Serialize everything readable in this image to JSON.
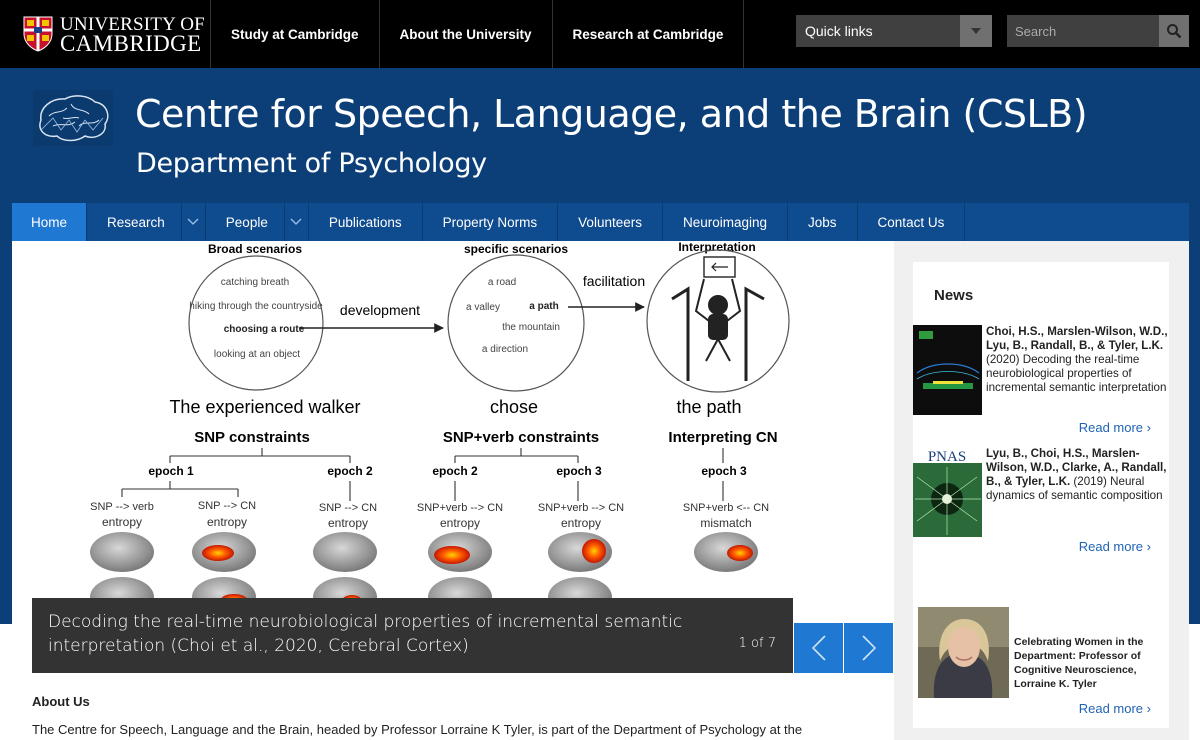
{
  "university": {
    "line1": "UNIVERSITY OF",
    "line2": "CAMBRIDGE"
  },
  "topnav": [
    "Study at Cambridge",
    "About the University",
    "Research at Cambridge"
  ],
  "quick_links": "Quick links",
  "search": {
    "placeholder": "Search"
  },
  "site": {
    "title": "Centre for Speech, Language, and the Brain (CSLB)",
    "subtitle": "Department of Psychology"
  },
  "mainnav": [
    {
      "label": "Home",
      "active": true
    },
    {
      "label": "Research",
      "dropdown": true
    },
    {
      "label": "People",
      "dropdown": true
    },
    {
      "label": "Publications"
    },
    {
      "label": "Property Norms"
    },
    {
      "label": "Volunteers"
    },
    {
      "label": "Neuroimaging"
    },
    {
      "label": "Jobs"
    },
    {
      "label": "Contact Us"
    }
  ],
  "figure": {
    "heads": [
      "Broad scenarios",
      "specific scenarios",
      "Interpretation"
    ],
    "broad": [
      "catching breath",
      "hiking through the countryside",
      "choosing a route",
      "looking at an object"
    ],
    "specific": [
      "a road",
      "a valley",
      "a path",
      "the mountain",
      "a direction"
    ],
    "arrows": [
      "development",
      "facilitation"
    ],
    "phrase": [
      "The experienced walker",
      "chose",
      "the path"
    ],
    "constraints": [
      "SNP constraints",
      "SNP+verb constraints",
      "Interpreting CN"
    ],
    "epochs": [
      "epoch 1",
      "epoch 2",
      "epoch 2",
      "epoch 3",
      "epoch 3"
    ],
    "measures": [
      [
        "SNP --> verb",
        "entropy"
      ],
      [
        "SNP --> CN",
        "entropy"
      ],
      [
        "SNP --> CN",
        "entropy"
      ],
      [
        "SNP+verb --> CN",
        "entropy"
      ],
      [
        "SNP+verb --> CN",
        "entropy"
      ],
      [
        "SNP+verb <-- CN",
        "mismatch"
      ]
    ]
  },
  "slider": {
    "caption": "Decoding the real-time neurobiological properties of incremental semantic interpretation (Choi et al., 2020, Cerebral Cortex)",
    "counter": "1 of 7"
  },
  "about": {
    "heading": "About Us",
    "text": "The Centre for Speech, Language and the Brain, headed by Professor Lorraine K Tyler, is part of the Department of Psychology at the"
  },
  "news": {
    "heading": "News",
    "items": [
      {
        "authors": "Choi, H.S., Marslen-Wilson, W.D., Lyu, B., Randall, B., & Tyler, L.K.",
        "rest": " (2020) Decoding the real-time neurobiological properties of incremental semantic interpretation",
        "read_more": "Read more"
      },
      {
        "journal": "PNAS",
        "authors": "Lyu, B., Choi, H.S., Marslen-Wilson, W.D., Clarke, A., Randall, B., & Tyler, L.K.",
        "rest": " (2019) Neural dynamics of semantic composition",
        "read_more": "Read more"
      },
      {
        "title": "Celebrating Women in the Department: Professor of Cognitive Neuroscience, Lorraine K. Tyler",
        "read_more": "Read more"
      }
    ]
  },
  "colors": {
    "black_bar": "#000000",
    "header_blue": "#0c3f78",
    "accent_blue": "#1f78d1"
  }
}
